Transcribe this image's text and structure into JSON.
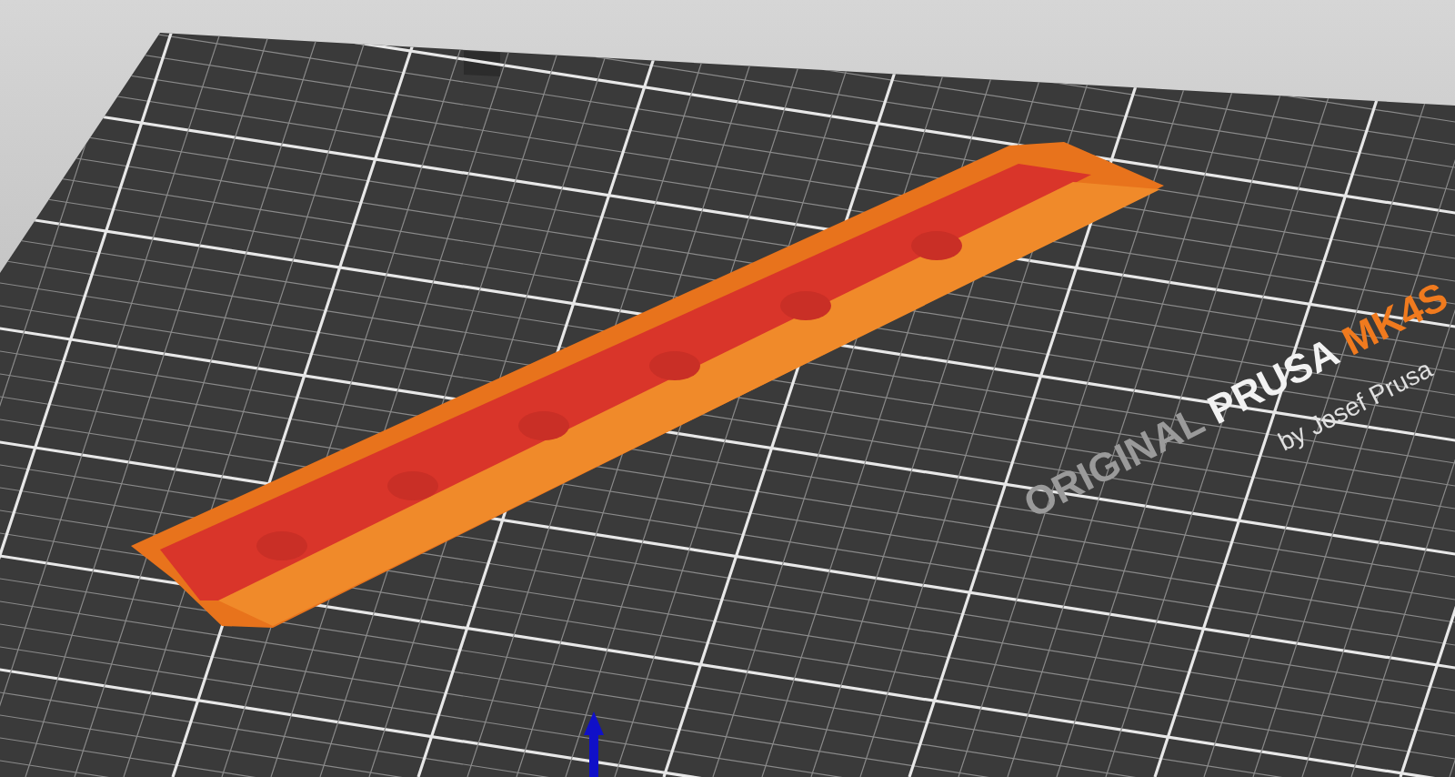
{
  "bed_logo": {
    "brand": "ORIGINAL",
    "name": "PRUSA",
    "model": "MK4S",
    "byline": "by Josef Prusa"
  }
}
